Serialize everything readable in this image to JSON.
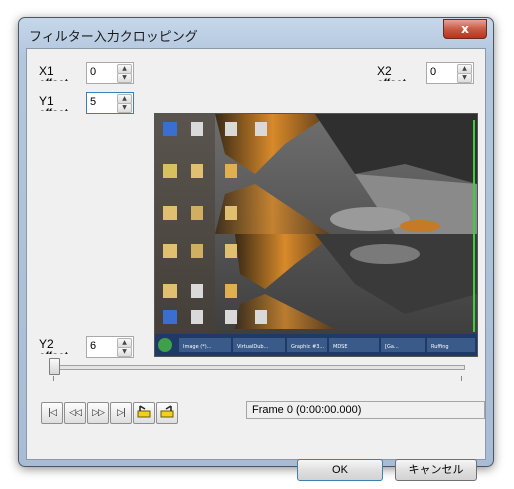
{
  "window": {
    "title": "フィルター入力クロッピング",
    "close_glyph": "x"
  },
  "x1": {
    "label": "X1 offset",
    "value": "0"
  },
  "y1": {
    "label": "Y1 offset",
    "value": "5"
  },
  "x2": {
    "label": "X2 offset",
    "value": "0"
  },
  "y2": {
    "label": "Y2 offset",
    "value": "6"
  },
  "nav_buttons": [
    {
      "icon": "first-frame-icon",
      "glyph": "|◁"
    },
    {
      "icon": "step-back-icon",
      "glyph": "◁◁"
    },
    {
      "icon": "step-forward-icon",
      "glyph": "▷▷"
    },
    {
      "icon": "last-frame-icon",
      "glyph": "▷|"
    },
    {
      "icon": "mark-in-icon",
      "glyph": ""
    },
    {
      "icon": "mark-out-icon",
      "glyph": ""
    }
  ],
  "frame_status": "Frame 0 (0:00:00.000)",
  "buttons": {
    "ok": "OK",
    "cancel": "キャンセル"
  },
  "slider": {
    "position": 0
  },
  "taskbar_items": [
    "Image (*)...",
    "VirtualDub...",
    "Graphic #3...",
    "MDSE",
    "[Ga...",
    "Ruffing"
  ]
}
